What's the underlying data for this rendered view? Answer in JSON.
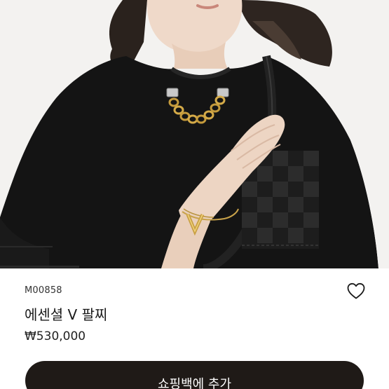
{
  "product": {
    "sku": "M00858",
    "name": "에센셜 V 팔찌",
    "price": "₩530,000"
  },
  "actions": {
    "add_to_bag_label": "쇼핑백에 추가",
    "wishlist_icon": "heart-outline-icon"
  },
  "colors": {
    "button_bg": "#1f1a17",
    "text": "#1a1a1a",
    "page_bg": "#ffffff"
  }
}
